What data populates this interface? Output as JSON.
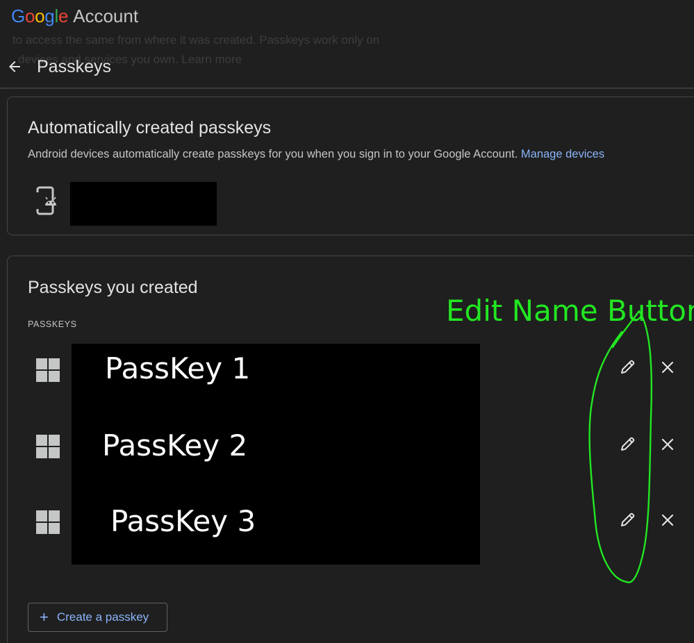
{
  "header": {
    "brand_logo": "Google",
    "brand_text": "Account",
    "ghost_line_1": "to access the same from where it was created. Passkeys work only on",
    "ghost_line_2": "devices and services you own. Learn more",
    "page_title": "Passkeys"
  },
  "auto_section": {
    "title": "Automatically created passkeys",
    "description": "Android devices automatically create passkeys for you when you sign in to your Google Account.",
    "link_label": "Manage devices",
    "device_icon": "android-phone-icon"
  },
  "created_section": {
    "title": "Passkeys you created",
    "list_label": "PASSKEYS",
    "passkeys": [
      {
        "name": "PassKey 1",
        "icon": "windows-icon"
      },
      {
        "name": "PassKey 2",
        "icon": "windows-icon"
      },
      {
        "name": "PassKey 3",
        "icon": "windows-icon"
      }
    ],
    "create_button_label": "Create a passkey"
  },
  "annotation": {
    "text": "Edit Name Buttons",
    "color": "#22e622"
  },
  "colors": {
    "background": "#1f1f1f",
    "link": "#8ab4f8",
    "border": "#444746",
    "redaction": "#000000"
  }
}
